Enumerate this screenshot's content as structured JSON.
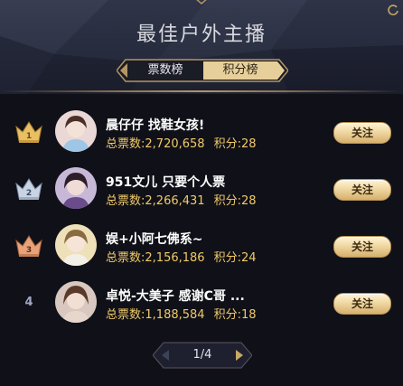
{
  "header": {
    "title": "最佳户外主播"
  },
  "tabs": [
    {
      "label": "票数榜",
      "active": true
    },
    {
      "label": "积分榜",
      "active": false
    }
  ],
  "stat_labels": {
    "votes": "总票数:",
    "points": "积分:"
  },
  "follow_label": "关注",
  "entries": [
    {
      "rank": "1",
      "badge": "gold-crown-icon",
      "name": "晨仔仔 找鞋女孩!",
      "votes": "2,720,658",
      "points": "28",
      "avatar_color": "#e9d8d6"
    },
    {
      "rank": "2",
      "badge": "silver-crown-icon",
      "name": "951文儿 只要个人票",
      "votes": "2,266,431",
      "points": "28",
      "avatar_color": "#c8b8d8"
    },
    {
      "rank": "3",
      "badge": "bronze-crown-icon",
      "name": "娱+小阿七佛系~",
      "votes": "2,156,186",
      "points": "24",
      "avatar_color": "#eee0b8"
    },
    {
      "rank": "4",
      "badge": "",
      "name": "卓悦-大美子 感谢C哥 ...",
      "votes": "1,188,584",
      "points": "18",
      "avatar_color": "#d8c8c0"
    }
  ],
  "pagination": {
    "text": "1/4"
  },
  "colors": {
    "gold_text": "#f1c96a",
    "follow_button": "#f0d8a3",
    "accent_line": "#b49665"
  }
}
